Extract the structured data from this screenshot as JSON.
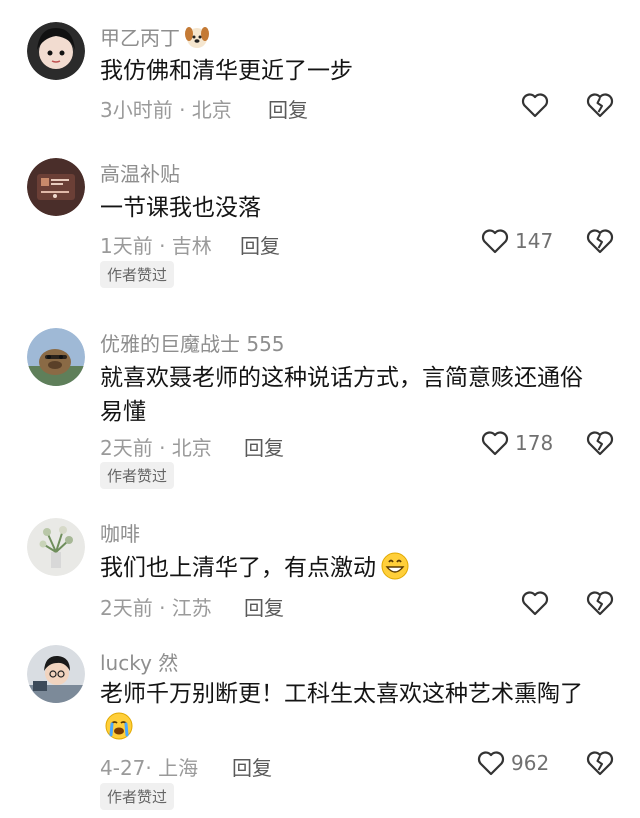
{
  "comments": [
    {
      "username": "甲乙丙丁",
      "text": "我仿佛和清华更近了一步",
      "meta": "3小时前 · 北京",
      "reply": "回复",
      "likes": ""
    },
    {
      "username": "高温补贴",
      "text": "一节课我也没落",
      "meta": "1天前 · 吉林",
      "reply": "回复",
      "likes": "147",
      "badge": "作者赞过"
    },
    {
      "username": "优雅的巨魔战士 555",
      "text": "就喜欢聂老师的这种说话方式，言简意赅还通俗易懂",
      "meta": "2天前 · 北京",
      "reply": "回复",
      "likes": "178",
      "badge": "作者赞过"
    },
    {
      "username": "咖啡",
      "text": "我们也上清华了，有点激动",
      "meta": "2天前 · 江苏",
      "reply": "回复",
      "likes": ""
    },
    {
      "username": "lucky 然",
      "text": "老师千万别断更！工科生太喜欢这种艺术熏陶了",
      "meta": "4-27· 上海",
      "reply": "回复",
      "likes": "962",
      "badge": "作者赞过"
    }
  ],
  "icons": {
    "like": "heart-outline-icon",
    "dislike": "broken-heart-icon",
    "dog": "dog-emoji-icon",
    "grin": "grinning-emoji-icon",
    "cry": "crying-emoji-icon"
  }
}
